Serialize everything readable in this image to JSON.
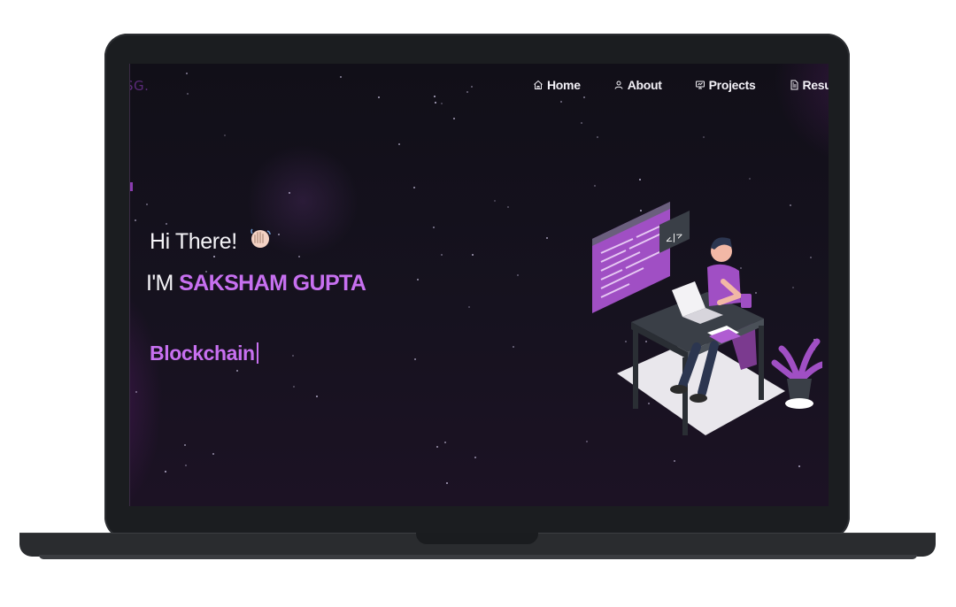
{
  "nav": {
    "logo": "SG.",
    "items": [
      {
        "label": "Home",
        "icon": "home-icon"
      },
      {
        "label": "About",
        "icon": "user-icon"
      },
      {
        "label": "Projects",
        "icon": "projects-icon"
      },
      {
        "label": "Resu",
        "icon": "resume-icon"
      }
    ]
  },
  "hero": {
    "greeting": "Hi There!",
    "intro_prefix": "I'M",
    "name": "SAKSHAM GUPTA",
    "typed_text": "Blockchain"
  },
  "colors": {
    "accent": "#c770f0",
    "background": "#13111b",
    "frame": "#1b1d20"
  }
}
